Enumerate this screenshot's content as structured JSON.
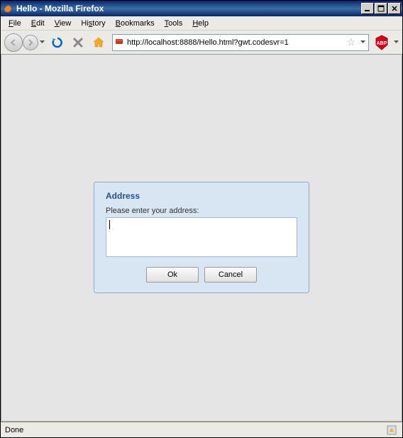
{
  "window": {
    "title": "Hello - Mozilla Firefox"
  },
  "menu": {
    "file": "File",
    "edit": "Edit",
    "view": "View",
    "history": "History",
    "bookmarks": "Bookmarks",
    "tools": "Tools",
    "help": "Help"
  },
  "toolbar": {
    "url": "http://localhost:8888/Hello.html?gwt.codesvr=1"
  },
  "dialog": {
    "title": "Address",
    "label": "Please enter your address:",
    "value": "",
    "ok": "Ok",
    "cancel": "Cancel"
  },
  "status": {
    "text": "Done"
  }
}
